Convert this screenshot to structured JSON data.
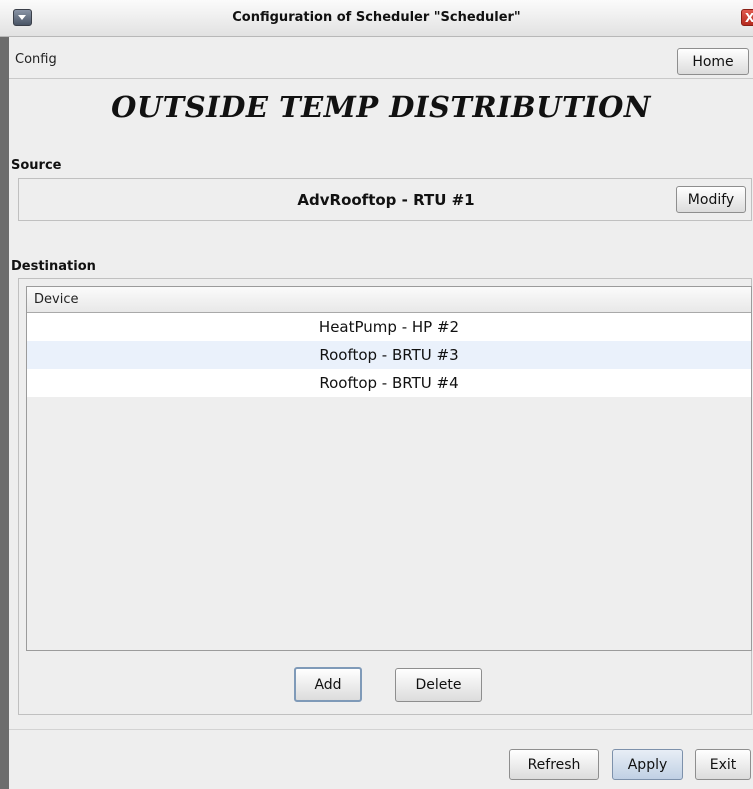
{
  "window": {
    "title": "Configuration of Scheduler \"Scheduler\"",
    "close_glyph": "X"
  },
  "menubar": {
    "config_label": "Config",
    "home_label": "Home"
  },
  "page": {
    "title": "OUTSIDE TEMP DISTRIBUTION"
  },
  "source": {
    "label": "Source",
    "device": "AdvRooftop - RTU #1",
    "modify_label": "Modify"
  },
  "destination": {
    "label": "Destination",
    "column_header": "Device",
    "rows": [
      "HeatPump - HP #2",
      "Rooftop - BRTU #3",
      "Rooftop - BRTU #4"
    ],
    "add_label": "Add",
    "delete_label": "Delete"
  },
  "footer": {
    "refresh_label": "Refresh",
    "apply_label": "Apply",
    "exit_label": "Exit"
  },
  "colors": {
    "row_alt": "#eaf1fb",
    "close_button": "#c8382b"
  },
  "icons": [
    "window-menu-icon",
    "close-icon"
  ]
}
